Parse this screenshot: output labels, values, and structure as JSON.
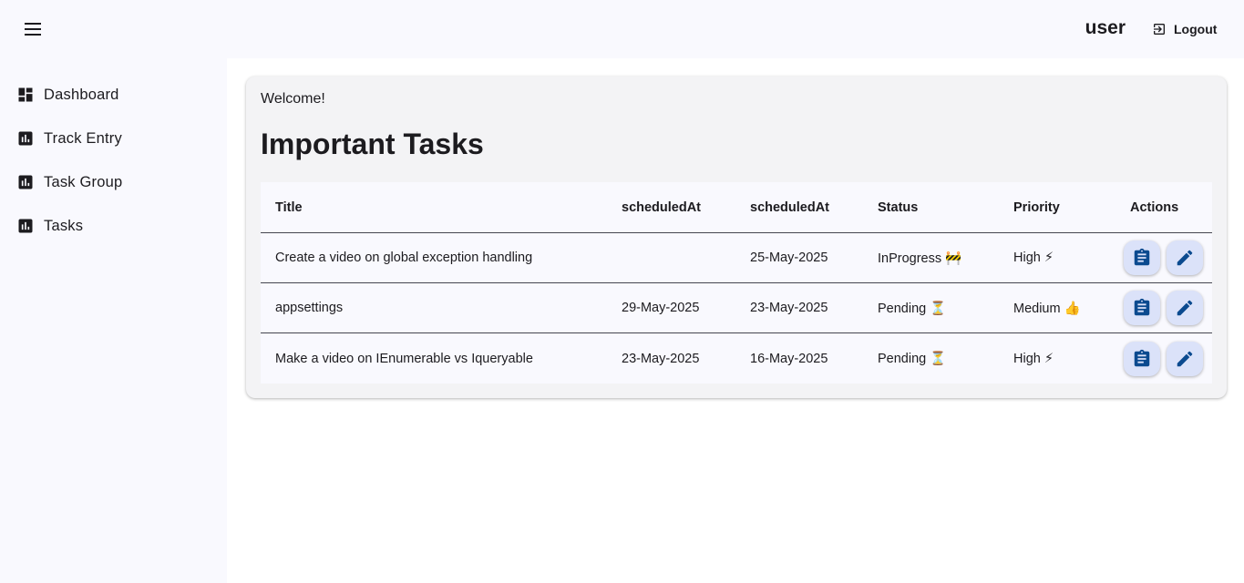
{
  "header": {
    "username": "user",
    "logout_label": "Logout"
  },
  "sidebar": {
    "items": [
      {
        "label": "Dashboard",
        "icon": "dashboard-icon"
      },
      {
        "label": "Track Entry",
        "icon": "bar-chart-icon"
      },
      {
        "label": "Task Group",
        "icon": "bar-chart-icon"
      },
      {
        "label": "Tasks",
        "icon": "bar-chart-icon"
      }
    ]
  },
  "main": {
    "welcome": "Welcome!",
    "title": "Important Tasks",
    "table": {
      "columns": [
        "Title",
        "scheduledAt",
        "scheduledAt",
        "Status",
        "Priority",
        "Actions"
      ],
      "rows": [
        {
          "title": "Create a video on global exception handling",
          "scheduled1": "",
          "scheduled2": "25-May-2025",
          "status": "InProgress 🚧",
          "priority": "High ⚡"
        },
        {
          "title": "appsettings",
          "scheduled1": "29-May-2025",
          "scheduled2": "23-May-2025",
          "status": "Pending ⏳",
          "priority": "Medium 👍"
        },
        {
          "title": "Make a video on IEnumerable vs Iqueryable",
          "scheduled1": "23-May-2025",
          "scheduled2": "16-May-2025",
          "status": "Pending ⏳",
          "priority": "High ⚡"
        }
      ]
    }
  },
  "colors": {
    "action_button_bg": "#dbe2f9",
    "action_icon": "#0b4a8f",
    "sidebar_bg": "#f9f9fe"
  }
}
